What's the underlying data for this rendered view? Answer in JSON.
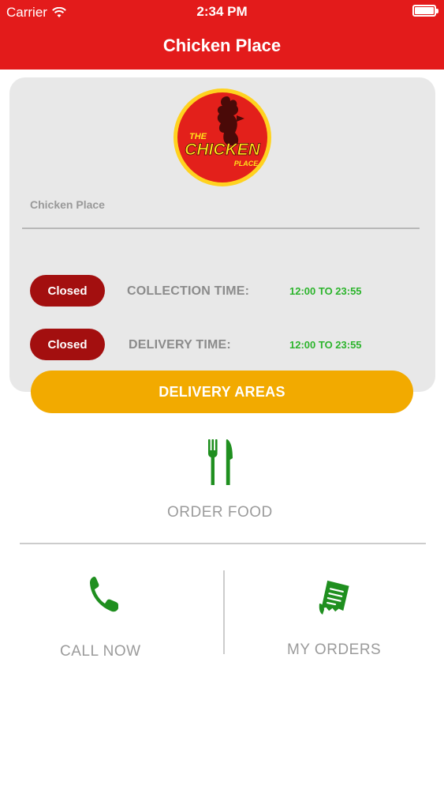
{
  "status_bar": {
    "carrier": "Carrier",
    "time": "2:34 PM"
  },
  "header": {
    "title": "Chicken Place"
  },
  "restaurant": {
    "logo_text_top": "THE",
    "logo_text_main": "CHICKEN",
    "logo_text_bottom": "PLACE",
    "name": "Chicken Place"
  },
  "hours": [
    {
      "status": "Closed",
      "label": "COLLECTION TIME:",
      "value": "12:00 TO 23:55"
    },
    {
      "status": "Closed",
      "label": "DELIVERY TIME:",
      "value": "12:00 TO 23:55"
    }
  ],
  "delivery_areas_label": "DELIVERY AREAS",
  "actions": {
    "order_food": "ORDER FOOD",
    "call_now": "CALL NOW",
    "my_orders": "MY ORDERS"
  },
  "icons": {
    "order_food": "cutlery-icon",
    "call_now": "phone-icon",
    "my_orders": "receipt-icon",
    "wifi": "wifi-icon",
    "battery": "battery-icon"
  },
  "colors": {
    "header": "#e31b1b",
    "card": "#e8e8e8",
    "closed_badge": "#a30f0f",
    "time_value": "#2cb42c",
    "delivery_button": "#f2aa00",
    "icon_green": "#1f8f1f",
    "label_gray": "#9b9b9b"
  }
}
